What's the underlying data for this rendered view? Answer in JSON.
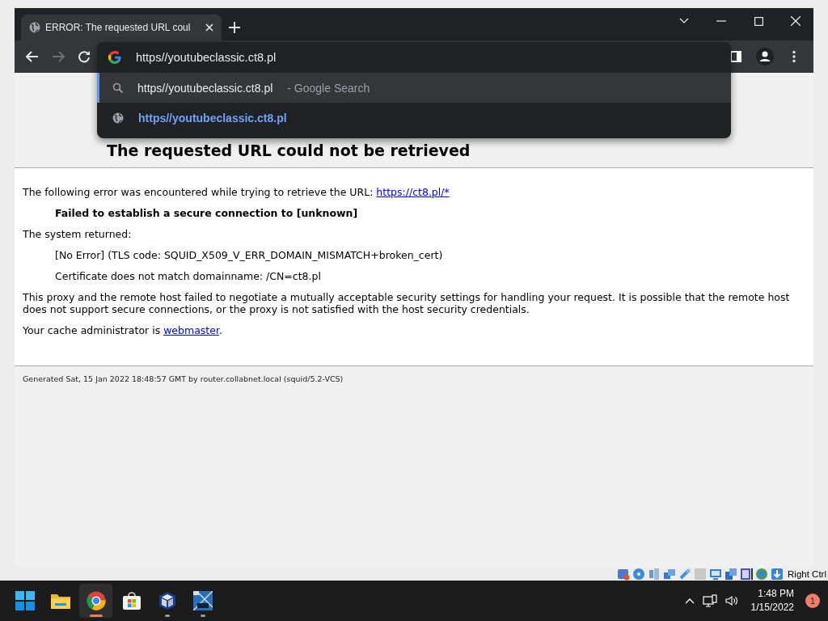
{
  "tab": {
    "title": "ERROR: The requested URL coul",
    "selected": true
  },
  "omnibox": {
    "value": "https//youtubeclassic.ct8.pl"
  },
  "suggestions": [
    {
      "kind": "search",
      "text": "https//youtubeclassic.ct8.pl",
      "suffix": "- Google Search",
      "selected": true
    },
    {
      "kind": "url",
      "text": "https//youtubeclassic.ct8.pl",
      "selected": false
    }
  ],
  "page": {
    "heading": "The requested URL could not be retrieved",
    "blocks": [
      {
        "kind": "plain",
        "text": "The following error was encountered while trying to retrieve the URL: ",
        "link": "https://ct8.pl/*"
      },
      {
        "kind": "strong",
        "text": "Failed to establish a secure connection to [unknown]"
      },
      {
        "kind": "plain",
        "text": "The system returned:"
      },
      {
        "kind": "indented",
        "text": "[No Error] (TLS code: SQUID_X509_V_ERR_DOMAIN_MISMATCH+broken_cert)"
      },
      {
        "kind": "indented",
        "text": "Certificate does not match domainname: /CN=ct8.pl"
      },
      {
        "kind": "plain",
        "text": "This proxy and the remote host failed to negotiate a mutually acceptable security settings for handling your request. It is possible that the remote host does not support secure connections, or the proxy is not satisfied with the host security credentials."
      },
      {
        "kind": "plain",
        "text": "Your cache administrator is ",
        "link": "webmaster",
        "after": "."
      }
    ],
    "footer": "Generated Sat, 15 Jan 2022 18:48:57 GMT by router.collabnet.local (squid/5.2-VCS)"
  },
  "vm_status": {
    "host_key": "Right Ctrl"
  },
  "taskbar": {
    "apps": [
      {
        "kind": "start",
        "selected": false,
        "running": false
      },
      {
        "kind": "folder",
        "selected": false,
        "running": false
      },
      {
        "kind": "chrome",
        "selected": true,
        "running": true
      },
      {
        "kind": "store",
        "selected": false,
        "running": false
      },
      {
        "kind": "virtualbox",
        "selected": false,
        "running": true
      },
      {
        "kind": "vista",
        "selected": false,
        "running": true
      }
    ],
    "time": "1:48 PM",
    "date": "1/15/2022",
    "notifications": "1"
  }
}
